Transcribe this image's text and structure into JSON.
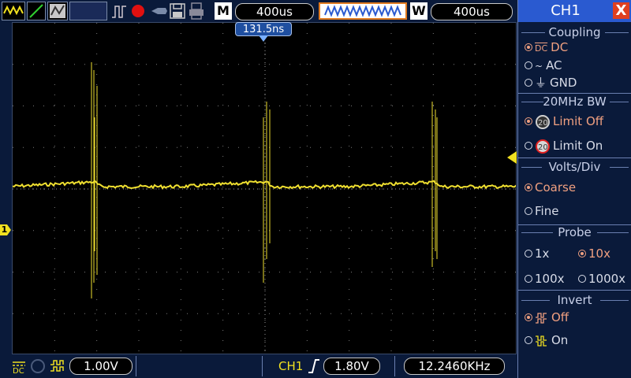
{
  "toolbar": {
    "timebase_mode": "M",
    "timebase_value": "400us",
    "window_mode": "W",
    "window_value": "400us"
  },
  "screen": {
    "trigger_time": "131.5ns",
    "channel_marker": "1"
  },
  "status": {
    "ch1_scale": "1.00V",
    "trigger_source": "CH1",
    "trigger_level": "1.80V",
    "frequency": "12.2460KHz"
  },
  "panel": {
    "title": "CH1",
    "close": "X",
    "coupling": {
      "title": "Coupling",
      "options": [
        {
          "label": "DC",
          "selected": true
        },
        {
          "label": "AC",
          "selected": false
        },
        {
          "label": "GND",
          "selected": false
        }
      ]
    },
    "bw": {
      "title": "20MHz BW",
      "options": [
        {
          "label": "Limit Off",
          "selected": true
        },
        {
          "label": "Limit On",
          "selected": false
        }
      ]
    },
    "volts": {
      "title": "Volts/Div",
      "options": [
        {
          "label": "Coarse",
          "selected": true
        },
        {
          "label": "Fine",
          "selected": false
        }
      ]
    },
    "probe": {
      "title": "Probe",
      "options": [
        {
          "label": "1x",
          "selected": false
        },
        {
          "label": "10x",
          "selected": true
        },
        {
          "label": "100x",
          "selected": false
        },
        {
          "label": "1000x",
          "selected": false
        }
      ]
    },
    "invert": {
      "title": "Invert",
      "options": [
        {
          "label": "Off",
          "selected": true
        },
        {
          "label": "On",
          "selected": false
        }
      ]
    }
  },
  "colors": {
    "trace": "#f0e030",
    "panel_bg": "#0a1a3a",
    "accent": "#2a5ad0",
    "selected": "#f0a080"
  }
}
